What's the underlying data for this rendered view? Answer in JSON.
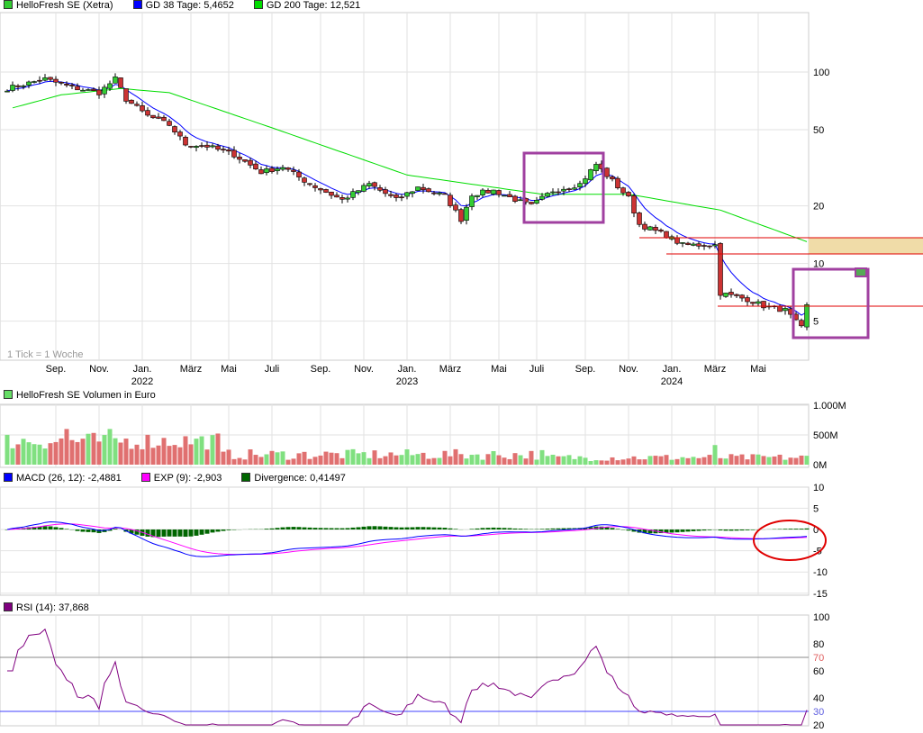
{
  "legend_main": {
    "price": "HelloFresh SE (Xetra)",
    "gd38": "GD 38 Tage: 5,4652",
    "gd200": "GD 200 Tage: 12,521"
  },
  "legend_volume": "HelloFresh SE Volumen in Euro",
  "legend_macd": {
    "macd": "MACD (26, 12): -2,4881",
    "exp": "EXP (9): -2,903",
    "div": "Divergence: 0,41497"
  },
  "legend_rsi": "RSI (14): 37,868",
  "tick_note": "1 Tick = 1 Woche",
  "colors": {
    "up": "#33cc33",
    "down": "#cc3333",
    "gd38": "#0000ff",
    "gd200": "#00dd00",
    "macd": "#0000ff",
    "exp": "#ff00ff",
    "div": "#006600",
    "rsi": "#800080",
    "annot_box": "#a040a0",
    "annot_line": "#e00000",
    "band": "#f0dca8"
  },
  "chart_data": [
    {
      "type": "candlestick",
      "title": "HelloFresh SE (Xetra)",
      "yscale": "log",
      "yticks": [
        "100",
        "50",
        "20",
        "10",
        "5"
      ],
      "ytick_values": [
        100,
        50,
        20,
        10,
        5
      ],
      "xticks": [
        "Sep.",
        "Nov.",
        "Jan.",
        "März",
        "Mai",
        "Juli",
        "Sep.",
        "Nov.",
        "Jan.",
        "März",
        "Mai",
        "Juli",
        "Sep.",
        "Nov.",
        "Jan.",
        "März",
        "Mai"
      ],
      "xtick_weeks": [
        9,
        17,
        25,
        34,
        41,
        49,
        58,
        66,
        74,
        82,
        91,
        98,
        107,
        115,
        123,
        131,
        139
      ],
      "years": [
        {
          "label": "2022",
          "week": 25
        },
        {
          "label": "2023",
          "week": 74
        },
        {
          "label": "2024",
          "week": 123
        }
      ],
      "close_anchors": [
        [
          0,
          82
        ],
        [
          7,
          92
        ],
        [
          12,
          83
        ],
        [
          17,
          78
        ],
        [
          20,
          92
        ],
        [
          22,
          72
        ],
        [
          26,
          59
        ],
        [
          30,
          53
        ],
        [
          33,
          42
        ],
        [
          37,
          41
        ],
        [
          42,
          37
        ],
        [
          47,
          30
        ],
        [
          51,
          32
        ],
        [
          56,
          26
        ],
        [
          62,
          21.5
        ],
        [
          67,
          26
        ],
        [
          72,
          21.5
        ],
        [
          76,
          25
        ],
        [
          81,
          22.5
        ],
        [
          84,
          17
        ],
        [
          86,
          23
        ],
        [
          90,
          24
        ],
        [
          95,
          21
        ],
        [
          97,
          20
        ],
        [
          101,
          24
        ],
        [
          106,
          26
        ],
        [
          109,
          33
        ],
        [
          112,
          27
        ],
        [
          115,
          22
        ],
        [
          117,
          16
        ],
        [
          122,
          14
        ],
        [
          125,
          12.5
        ],
        [
          131,
          12.5
        ],
        [
          132,
          7
        ],
        [
          137,
          6.5
        ],
        [
          140,
          6.0
        ],
        [
          144,
          5.7
        ],
        [
          147,
          4.6
        ],
        [
          148,
          6.0
        ]
      ],
      "gd200_anchors": [
        [
          1,
          65
        ],
        [
          10,
          76
        ],
        [
          21,
          82
        ],
        [
          30,
          78
        ],
        [
          50,
          50
        ],
        [
          74,
          29
        ],
        [
          99,
          23
        ],
        [
          115,
          23
        ],
        [
          132,
          19
        ],
        [
          148,
          13
        ]
      ],
      "levels": [
        14.3,
        12.3,
        6.1
      ]
    },
    {
      "type": "bar",
      "title": "HelloFresh SE Volumen in Euro",
      "yticks": [
        "1.000M",
        "500M",
        "0M"
      ],
      "ylim": [
        0,
        1000
      ]
    },
    {
      "type": "line",
      "title": "MACD",
      "yticks": [
        "10",
        "5",
        "0",
        "-5",
        "-10",
        "-15"
      ],
      "ylim": [
        -15,
        10
      ]
    },
    {
      "type": "line",
      "title": "RSI (14)",
      "yticks": [
        "100",
        "80",
        "70",
        "60",
        "40",
        "30",
        "20"
      ],
      "ylim": [
        20,
        100
      ],
      "levels": [
        70,
        30
      ]
    }
  ]
}
